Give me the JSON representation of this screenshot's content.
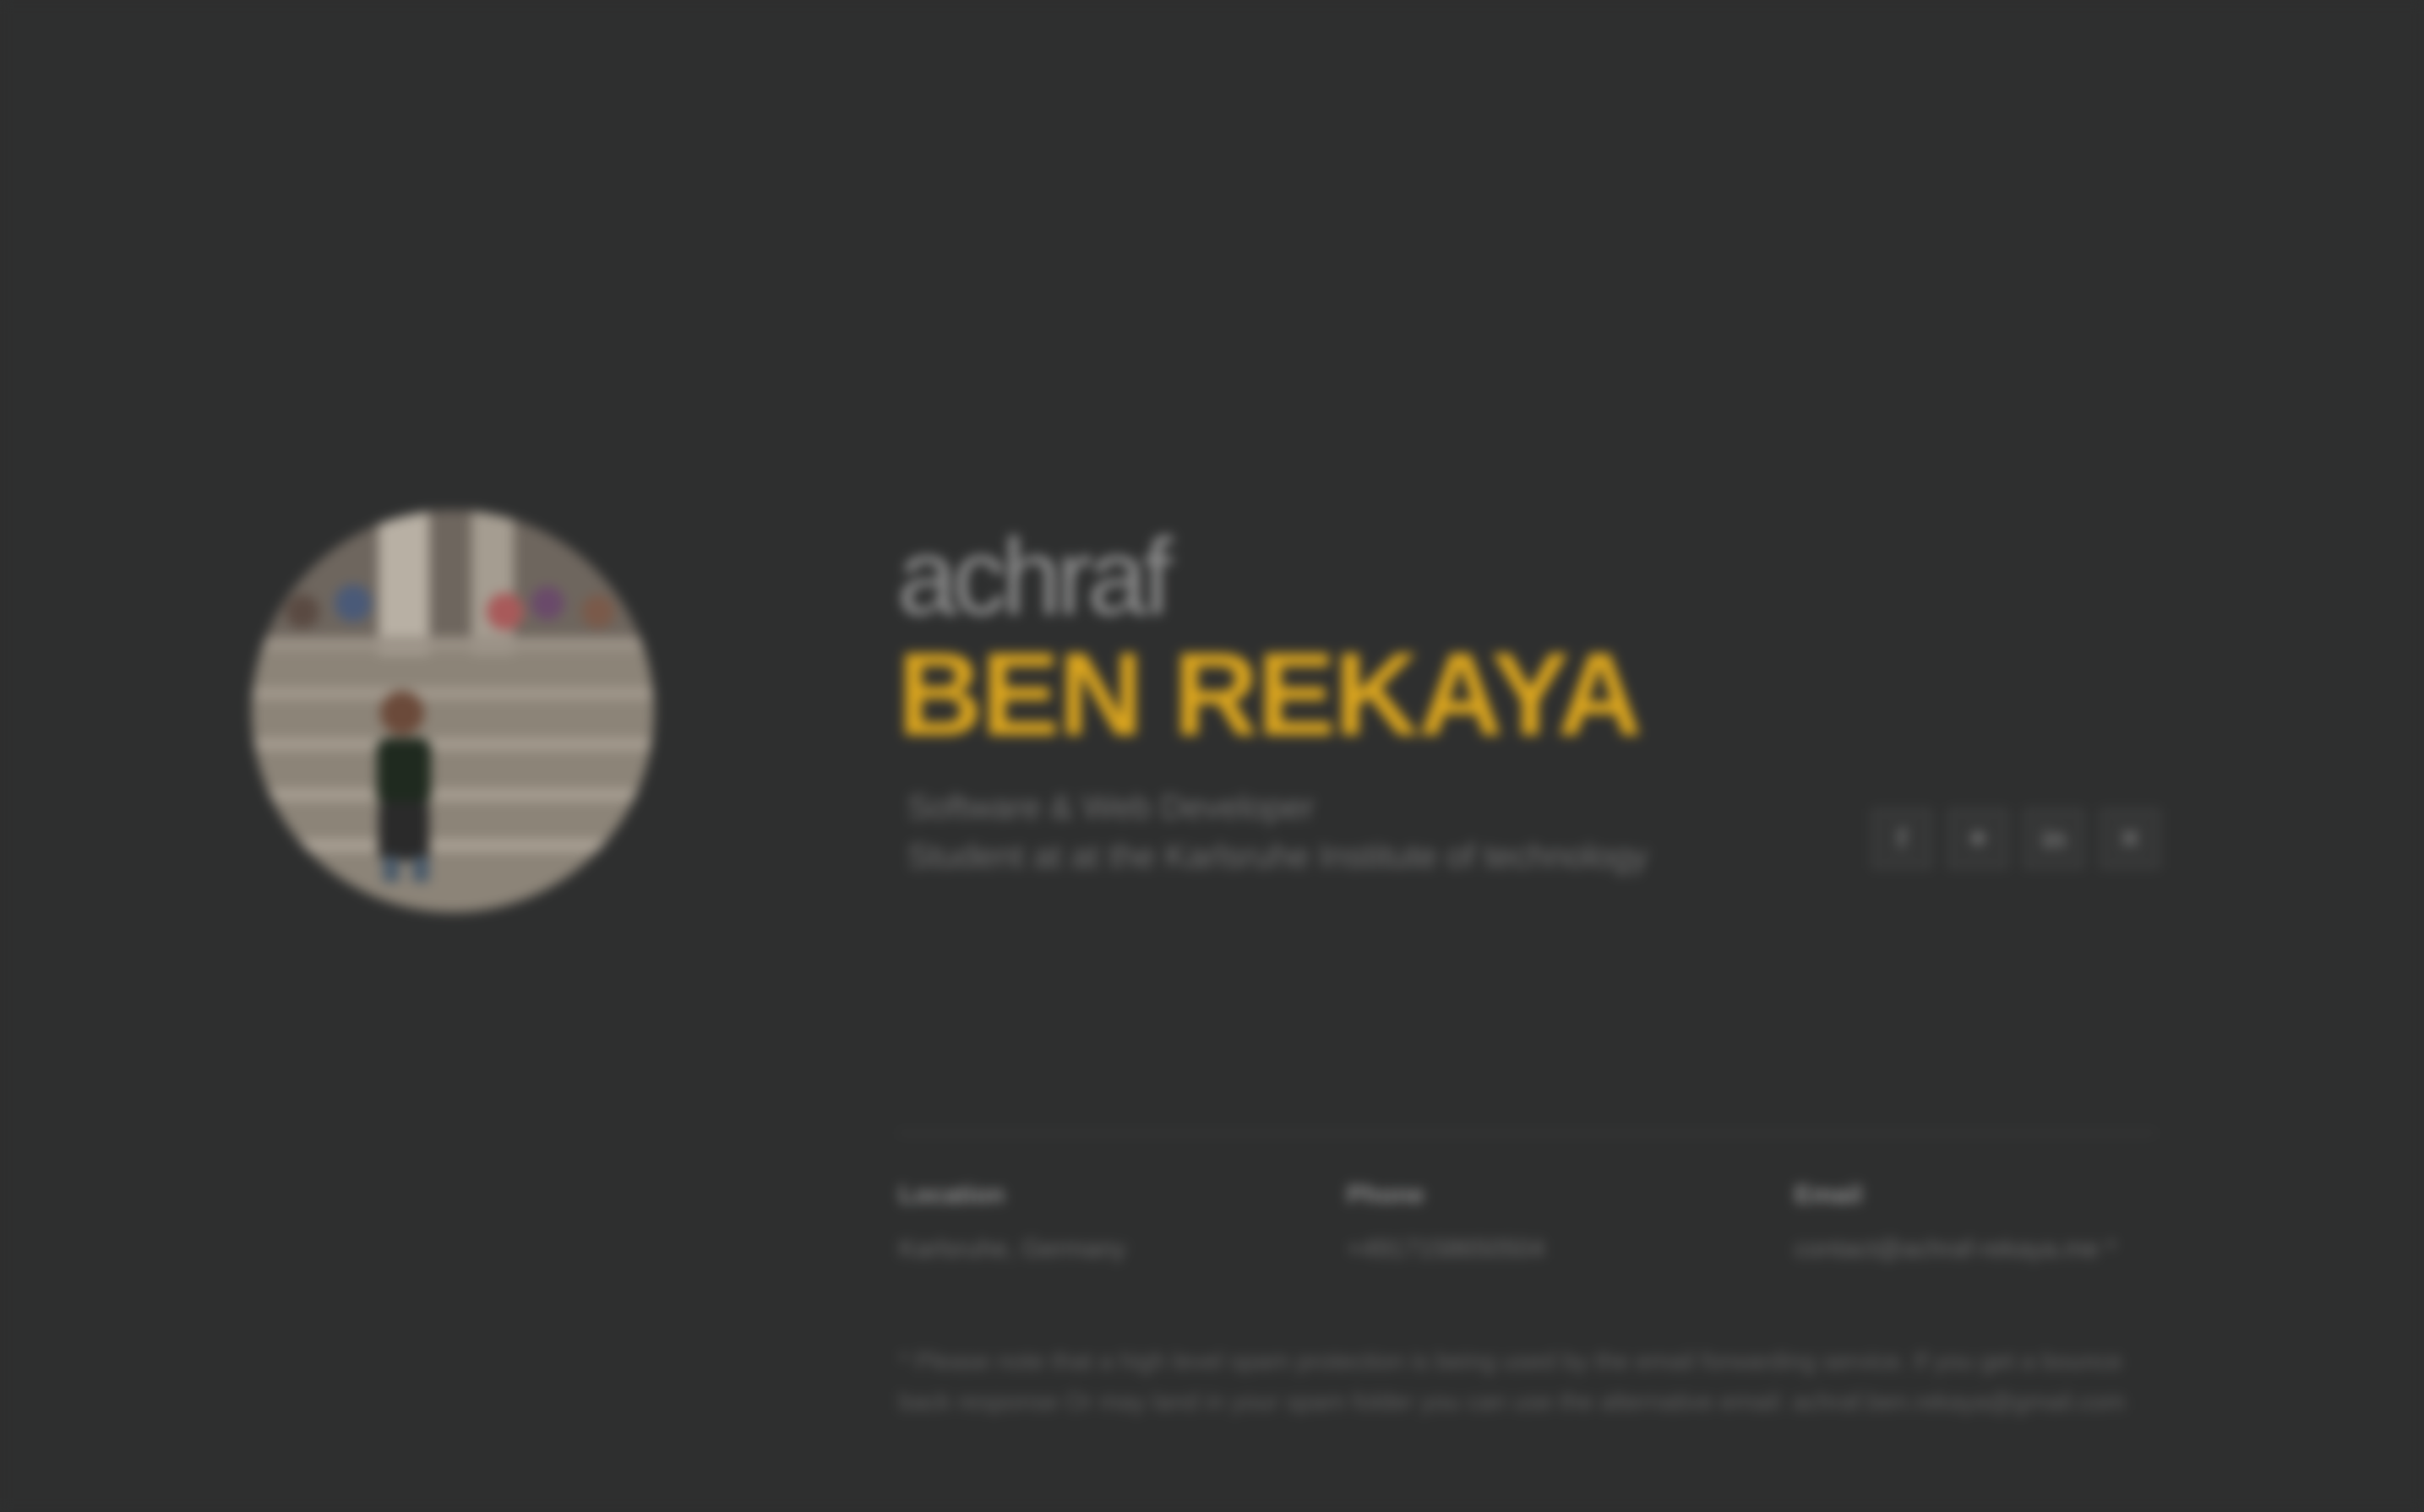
{
  "profile": {
    "first_name": "achraf",
    "last_name": "BEN REKAYA",
    "role": "Software & Web Developer",
    "education": "Student at at the Karlsruhe Institute of technology"
  },
  "social": [
    {
      "icon": "facebook-icon",
      "glyph": "f"
    },
    {
      "icon": "twitter-icon",
      "glyph": "✦"
    },
    {
      "icon": "linkedin-icon",
      "glyph": "in"
    },
    {
      "icon": "xing-icon",
      "glyph": "✕"
    }
  ],
  "contact": {
    "location_label": "Location",
    "location_value": "Karlsruhe, Germany",
    "phone_label": "Phone",
    "phone_value": "+4917158650504",
    "email_label": "Email",
    "email_value": "contact@achraf-rekaya.me *"
  },
  "note": "* Please note that a high level spam protection is being used by the email forwarding service. If you get a bounce back response Or may land in your spam folder you can use the alternative email: achraf.ben.rekaya@gmail.com",
  "colors": {
    "background": "#2e2f2f",
    "accent": "#d9a41e",
    "first_name": "#8e8e8e"
  }
}
